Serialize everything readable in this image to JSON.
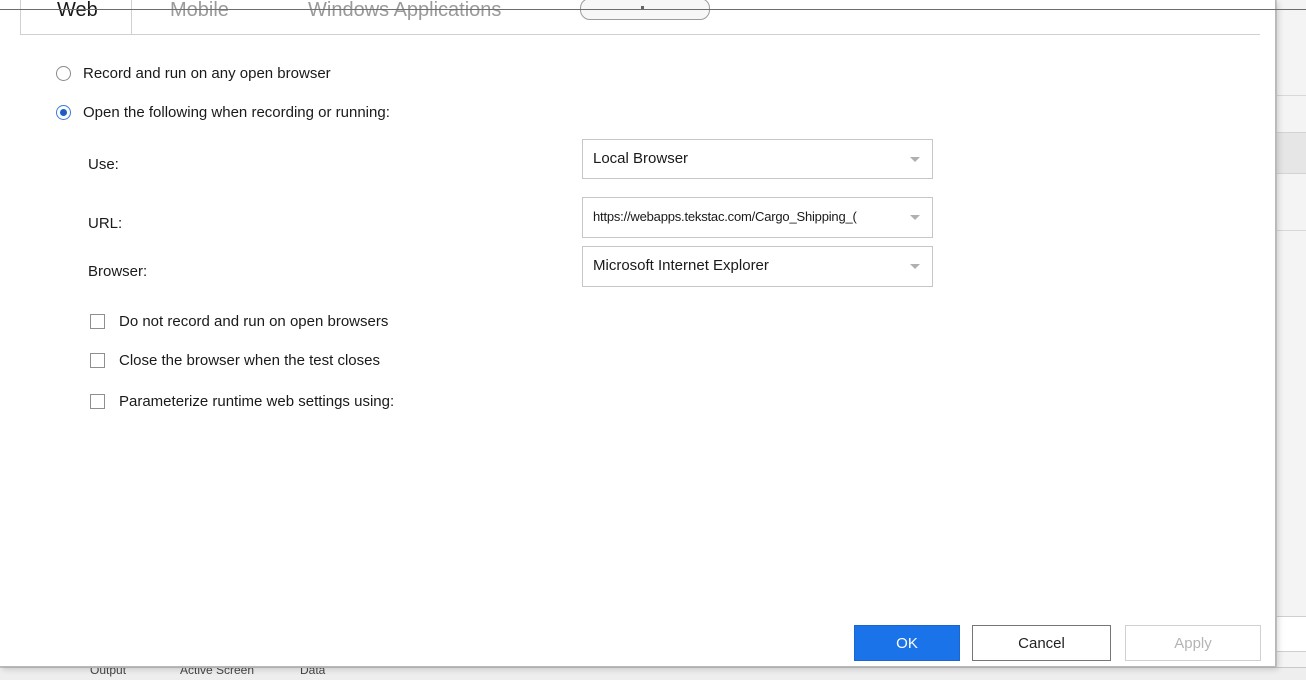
{
  "tabs": [
    "Web",
    "Mobile",
    "Windows Applications"
  ],
  "options": {
    "radio_any_browser": "Record and run on any open browser",
    "radio_open_following": "Open the following when recording or running:"
  },
  "fields": {
    "use_label": "Use:",
    "use_value": "Local Browser",
    "url_label": "URL:",
    "url_value": "https://webapps.tekstac.com/Cargo_Shipping_(",
    "browser_label": "Browser:",
    "browser_value": "Microsoft Internet Explorer"
  },
  "checkboxes": [
    "Do not record and run on open browsers",
    "Close the browser when the test closes",
    "Parameterize runtime web settings using:"
  ],
  "buttons": {
    "ok": "OK",
    "cancel": "Cancel",
    "apply": "Apply"
  },
  "background": {
    "status_items": [
      "Output",
      "Active Screen",
      "Data"
    ]
  },
  "colors": {
    "primary": "#1a73e8",
    "radio_selected": "#1b5fc2"
  }
}
